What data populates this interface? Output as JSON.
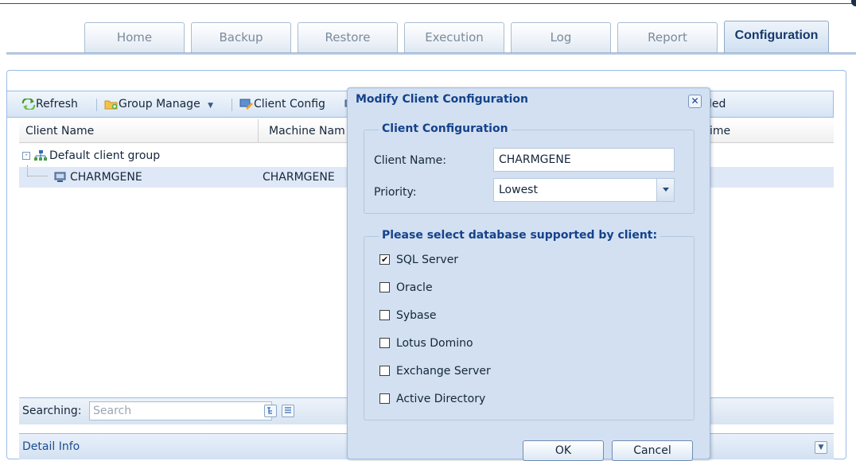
{
  "nav": {
    "tabs": [
      {
        "label": "Home"
      },
      {
        "label": "Backup"
      },
      {
        "label": "Restore"
      },
      {
        "label": "Execution"
      },
      {
        "label": "Log"
      },
      {
        "label": "Report"
      },
      {
        "label": "Configuration",
        "active": true
      }
    ]
  },
  "toolbar": {
    "refresh": "Refresh",
    "group_manage": "Group Manage",
    "client_config": "Client Config",
    "partial_right": "led"
  },
  "grid": {
    "columns": [
      "Client Name",
      "Machine Nam",
      "ime"
    ],
    "group_row": "Default client group",
    "client_row": {
      "name": "CHARMGENE",
      "machine": "CHARMGENE"
    }
  },
  "search": {
    "label": "Searching:",
    "placeholder": "Search"
  },
  "detail": {
    "title": "Detail Info"
  },
  "dialog": {
    "title": "Modify Client Configuration",
    "client_section": "Client Configuration",
    "client_name_label": "Client Name:",
    "client_name_value": "CHARMGENE",
    "priority_label": "Priority:",
    "priority_value": "Lowest",
    "db_section": "Please select database supported by client:",
    "databases": [
      {
        "label": "SQL Server",
        "checked": true
      },
      {
        "label": "Oracle",
        "checked": false
      },
      {
        "label": "Sybase",
        "checked": false
      },
      {
        "label": "Lotus Domino",
        "checked": false
      },
      {
        "label": "Exchange Server",
        "checked": false
      },
      {
        "label": "Active Directory",
        "checked": false
      }
    ],
    "ok": "OK",
    "cancel": "Cancel"
  },
  "colors": {
    "accent": "#15428b",
    "panel_border": "#99bbe8",
    "selected_row": "#dfe8f6"
  }
}
